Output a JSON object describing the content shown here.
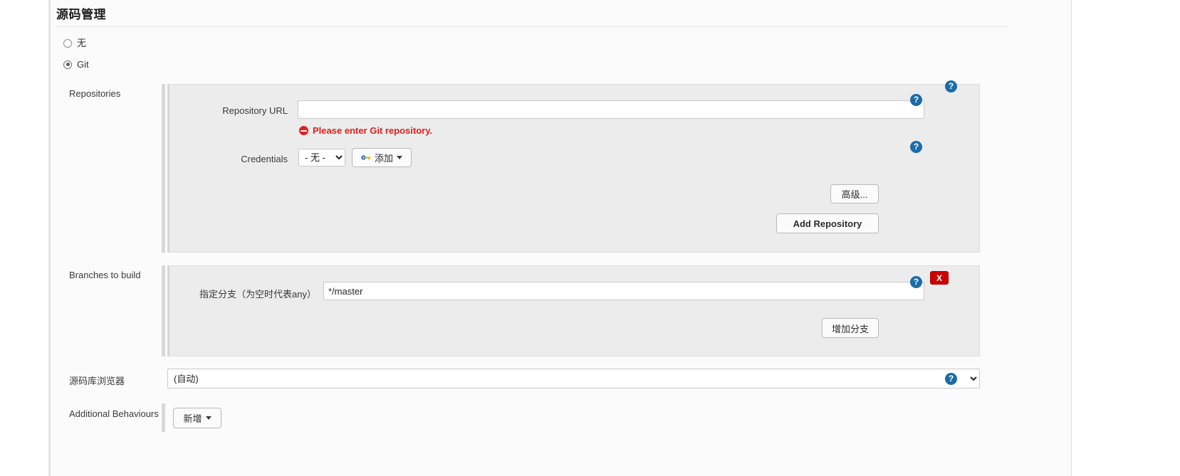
{
  "section": {
    "title": "源码管理"
  },
  "scm_options": [
    {
      "label": "无",
      "selected": false
    },
    {
      "label": "Git",
      "selected": true
    }
  ],
  "repositories": {
    "label": "Repositories",
    "repository_url": {
      "label": "Repository URL",
      "value": "",
      "placeholder": ""
    },
    "error": {
      "icon": "error-circle-icon",
      "text": "Please enter Git repository."
    },
    "credentials": {
      "label": "Credentials",
      "selected": "- 无 -",
      "options": [
        "- 无 -"
      ],
      "add_button": {
        "label": "添加",
        "icon": "key-icon"
      }
    },
    "advanced_button": "高级...",
    "add_repository_button": "Add Repository"
  },
  "branches": {
    "label": "Branches to build",
    "branch_spec": {
      "label": "指定分支（为空时代表any）",
      "value": "*/master"
    },
    "delete_button": "X",
    "add_branch_button": "增加分支"
  },
  "repository_browser": {
    "label": "源码库浏览器",
    "selected": "(自动)",
    "options": [
      "(自动)"
    ]
  },
  "additional_behaviours": {
    "label": "Additional Behaviours",
    "add_button": {
      "label": "新增"
    }
  },
  "help_icon": "?",
  "colors": {
    "accent_help": "#1b6ca8",
    "error": "#e02020",
    "delete": "#cc0000",
    "panel_bg": "#fbfbfb",
    "box_bg": "#ececec"
  }
}
